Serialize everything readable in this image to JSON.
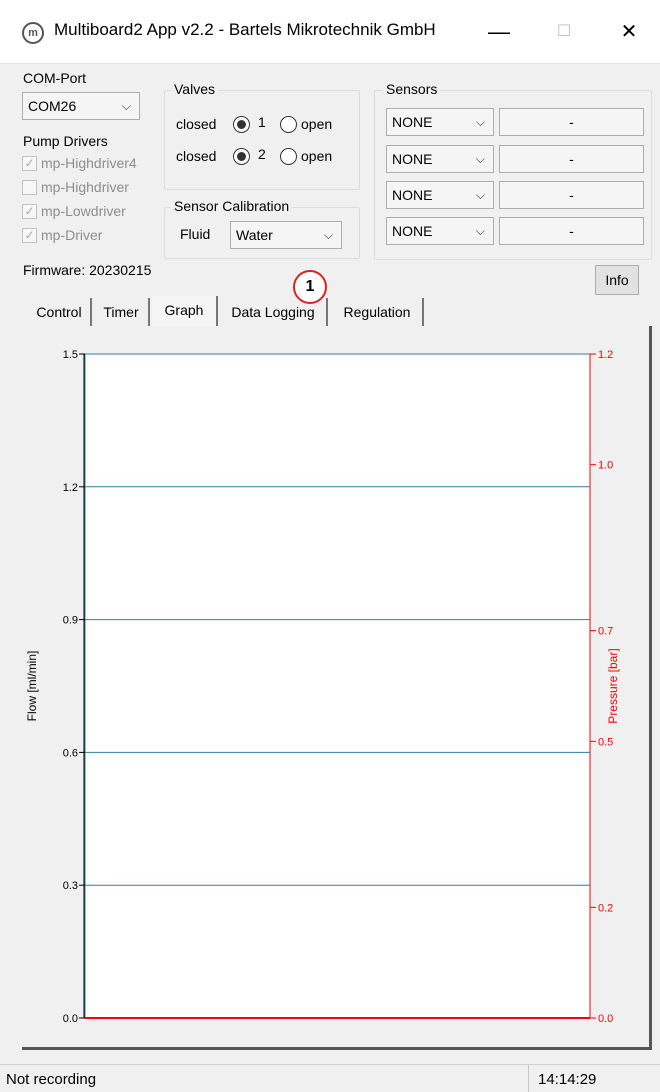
{
  "window": {
    "title": "Multiboard2 App v2.2 - Bartels Mikrotechnik GmbH",
    "icon_letter": "m",
    "minimize": "—",
    "maximize": "☐",
    "close": "✕"
  },
  "com_port": {
    "label": "COM-Port",
    "value": "COM26"
  },
  "pump_drivers": {
    "label": "Pump Drivers",
    "items": [
      {
        "label": "mp-Highdriver4",
        "checked": true
      },
      {
        "label": "mp-Highdriver",
        "checked": false
      },
      {
        "label": "mp-Lowdriver",
        "checked": true
      },
      {
        "label": "mp-Driver",
        "checked": true
      }
    ]
  },
  "valves": {
    "label": "Valves",
    "rows": [
      {
        "closed_label": "closed",
        "number": "1",
        "open_label": "open",
        "state": "closed"
      },
      {
        "closed_label": "closed",
        "number": "2",
        "open_label": "open",
        "state": "closed"
      }
    ]
  },
  "sensor_calibration": {
    "label": "Sensor Calibration",
    "fluid_label": "Fluid",
    "fluid_value": "Water"
  },
  "sensors": {
    "label": "Sensors",
    "rows": [
      {
        "type": "NONE",
        "value": "-"
      },
      {
        "type": "NONE",
        "value": "-"
      },
      {
        "type": "NONE",
        "value": "-"
      },
      {
        "type": "NONE",
        "value": "-"
      }
    ]
  },
  "firmware": "Firmware: 20230215",
  "info_button": "Info",
  "marker_label": "1",
  "tabs": [
    {
      "label": "Control",
      "active": false
    },
    {
      "label": "Timer",
      "active": false
    },
    {
      "label": "Graph",
      "active": true
    },
    {
      "label": "Data Logging",
      "active": false
    },
    {
      "label": "Regulation",
      "active": false
    }
  ],
  "chart_data": {
    "type": "line",
    "ylabel": "Flow [ml/min]",
    "y2label": "Pressure [bar]",
    "ylim": [
      0.0,
      1.5
    ],
    "y2lim": [
      0.0,
      1.2
    ],
    "yticks": [
      "0.0",
      "0.3",
      "0.6",
      "0.9",
      "1.2",
      "1.5"
    ],
    "y2ticks": [
      "0.0",
      "0.2",
      "0.5",
      "0.7",
      "1.0",
      "1.2"
    ],
    "grid": true,
    "colors": {
      "left_axis": "#000000",
      "right_axis": "#ff0000",
      "grid": "#2e7e9e",
      "plot_bg": "#ffffff"
    },
    "series": []
  },
  "status": {
    "left": "Not recording",
    "time": "14:14:29"
  }
}
